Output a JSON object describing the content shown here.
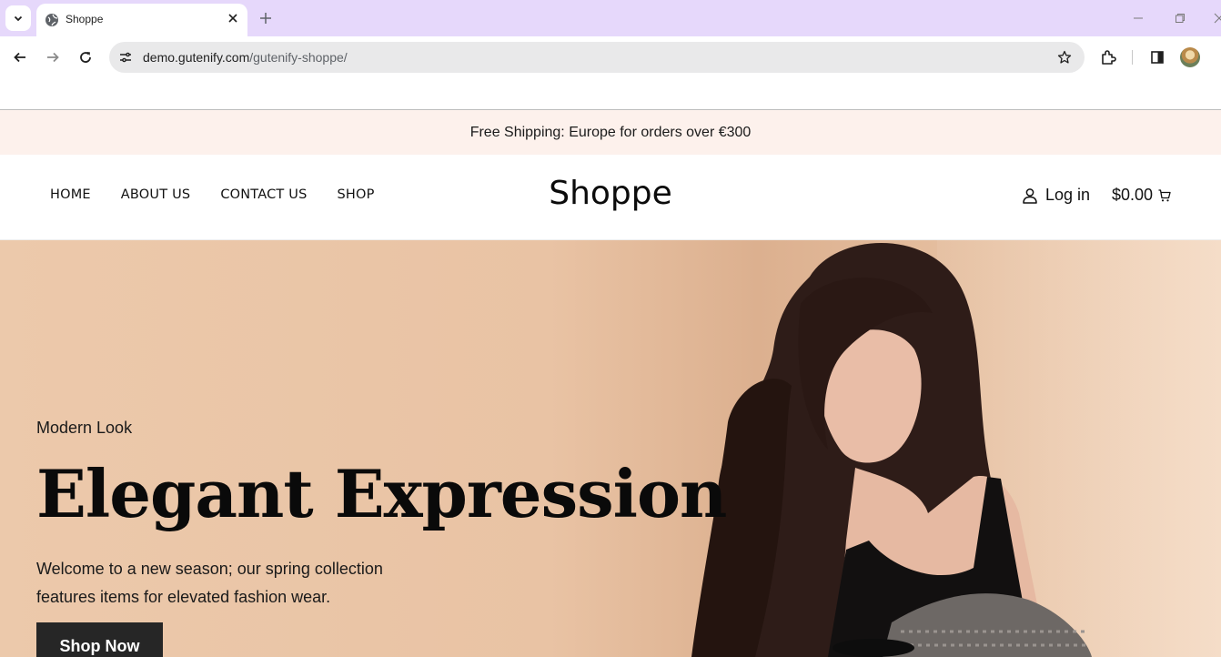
{
  "browser": {
    "tab_title": "Shoppe",
    "url_host": "demo.gutenify.com",
    "url_path": "/gutenify-shoppe/"
  },
  "site": {
    "announcement": "Free Shipping: Europe for orders over €300",
    "brand": "Shoppe",
    "menu": [
      {
        "label": "HOME"
      },
      {
        "label": "ABOUT US"
      },
      {
        "label": "CONTACT US"
      },
      {
        "label": "SHOP"
      }
    ],
    "login_label": "Log in",
    "cart_total": "$0.00"
  },
  "hero": {
    "eyebrow": "Modern Look",
    "headline": "Elegant Expression",
    "description": "Welcome to a new season; our spring collection features items for elevated fashion wear.",
    "cta_label": "Shop Now"
  },
  "colors": {
    "tabstrip": "#e6d8fb",
    "announcement_bg": "#fdf1ec",
    "hero_bg": "#e9c3a4",
    "cta_bg": "#262626"
  },
  "icons": [
    "tab-search-icon",
    "globe-icon",
    "close-icon",
    "plus-icon",
    "minimize-icon",
    "restore-icon",
    "back-arrow-icon",
    "forward-arrow-icon",
    "reload-icon",
    "site-info-icon",
    "star-icon",
    "extensions-icon",
    "side-panel-icon",
    "user-icon",
    "cart-icon"
  ]
}
